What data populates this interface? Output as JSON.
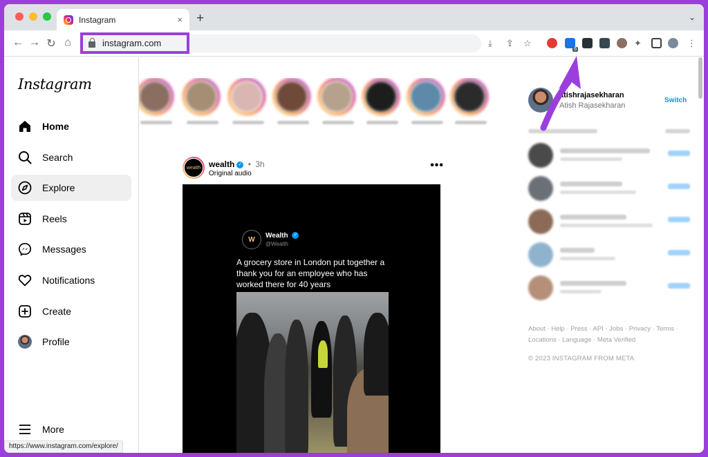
{
  "browser": {
    "tab_title": "Instagram",
    "tab_close": "×",
    "new_tab": "+",
    "tab_list": "⌄",
    "url": "instagram.com",
    "status_url": "https://www.instagram.com/explore/",
    "extension_badge": "6"
  },
  "instagram": {
    "logo": "Instagram",
    "nav": [
      {
        "label": "Home",
        "icon": "home-icon",
        "active": false,
        "bold": true
      },
      {
        "label": "Search",
        "icon": "search-icon",
        "active": false
      },
      {
        "label": "Explore",
        "icon": "compass-icon",
        "active": true
      },
      {
        "label": "Reels",
        "icon": "reels-icon",
        "active": false
      },
      {
        "label": "Messages",
        "icon": "messenger-icon",
        "active": false
      },
      {
        "label": "Notifications",
        "icon": "heart-icon",
        "active": false
      },
      {
        "label": "Create",
        "icon": "plus-square-icon",
        "active": false
      },
      {
        "label": "Profile",
        "icon": "avatar",
        "active": false
      }
    ],
    "more": "More",
    "post": {
      "username": "wealth",
      "separator": "•",
      "time": "3h",
      "audio": "Original audio",
      "more": "•••",
      "avatar_text": "wealth",
      "tweet": {
        "name": "Wealth",
        "handle": "@Wealth",
        "logo_letter": "W",
        "text": "A grocery store in London put together a thank you for an employee who has worked there for 40 years"
      }
    },
    "account": {
      "username": "atishrajasekharan",
      "full_name": "Atish Rajasekharan",
      "switch": "Switch"
    },
    "footer": {
      "links": [
        "About",
        "Help",
        "Press",
        "API",
        "Jobs",
        "Privacy",
        "Terms",
        "Locations",
        "Language",
        "Meta Verified"
      ],
      "copyright": "© 2023 INSTAGRAM FROM META"
    }
  },
  "colors": {
    "annotation": "#9b3fdc",
    "link_blue": "#0095f6"
  }
}
